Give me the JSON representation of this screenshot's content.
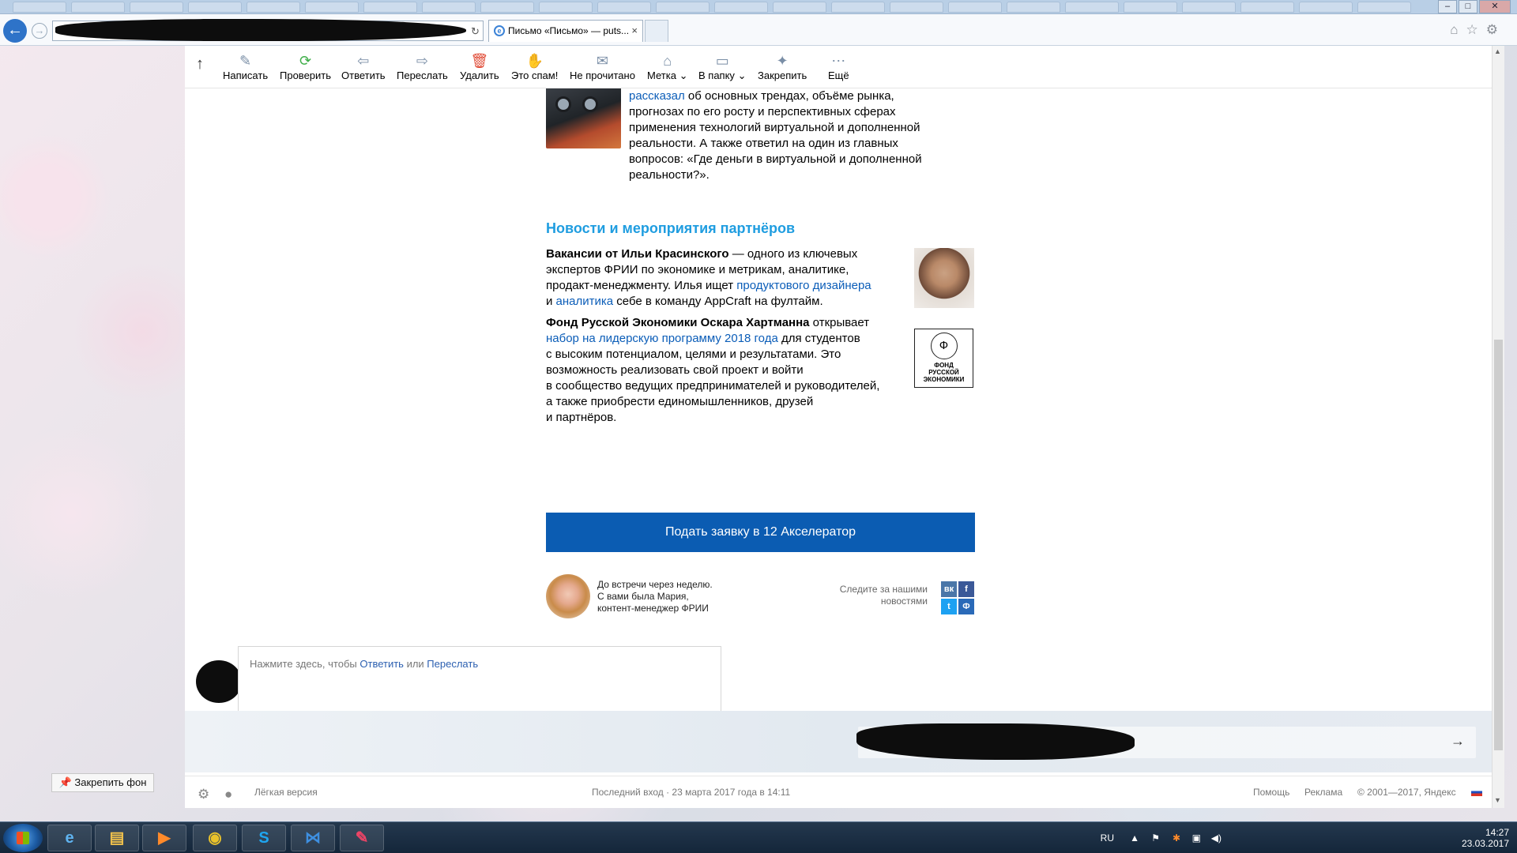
{
  "browser": {
    "tab_title": "Письмо «Письмо» — puts...",
    "tab_close": "×"
  },
  "toolbar": {
    "up_arrow": "↑",
    "items": [
      {
        "label": "Написать",
        "icon": "compose-icon"
      },
      {
        "label": "Проверить",
        "icon": "refresh-icon"
      },
      {
        "label": "Ответить",
        "icon": "reply-icon"
      },
      {
        "label": "Переслать",
        "icon": "forward-icon"
      },
      {
        "label": "Удалить",
        "icon": "trash-icon"
      },
      {
        "label": "Это спам!",
        "icon": "spam-hand-icon"
      },
      {
        "label": "Не прочитано",
        "icon": "envelope-icon"
      },
      {
        "label": "Метка",
        "icon": "tag-icon"
      },
      {
        "label": "В папку",
        "icon": "folder-icon"
      },
      {
        "label": "Закрепить",
        "icon": "pin-icon"
      },
      {
        "label": "Ещё",
        "icon": "more-icon"
      }
    ]
  },
  "mail": {
    "intro": {
      "link": "рассказал",
      "lines": [
        " об основных трендах, объёме рынка,",
        "прогнозах по его росту и перспективных сферах",
        "применения технологий виртуальной и дополненной",
        "реальности. А также ответил на один из главных",
        "вопросов: «Где деньги в виртуальной и дополненной",
        "реальности?»."
      ]
    },
    "section_title": "Новости и мероприятия партнёров",
    "item1": {
      "bold": "Вакансии от Ильи Красинского",
      "text1": " — одного из ключевых",
      "line2": "экспертов ФРИИ по экономике и метрикам, аналитике,",
      "line3a": "продакт-менеджменту. Илья ищет ",
      "link1": "продуктового дизайнера",
      "line4a": "и  ",
      "link2": "аналитика",
      "line4b": " себе в команду AppCraft на фултайм."
    },
    "item2": {
      "bold": "Фонд Русской Экономики Оскара Хартманна",
      "text1": " открывает",
      "link": "набор на лидерскую программу 2018 года",
      "text2": " для студентов",
      "lines": [
        "с высоким потенциалом, целями и результатами. Это",
        "возможность реализовать свой проект и войти",
        "в сообщество ведущих предпринимателей и руководителей,",
        "а также приобрести единомышленников, друзей",
        "и партнёров."
      ],
      "logo_glyph": "Ф",
      "logo_lines": [
        "ФОНД",
        "РУССКОЙ",
        "ЭКОНОМИКИ"
      ]
    },
    "cta_label": "Подать заявку в 12 Акселератор",
    "signature": [
      "До встречи через неделю.",
      "С вами была Мария,",
      "контент-менеджер ФРИИ"
    ],
    "follow_text": [
      "Следите за нашими",
      "новостями"
    ],
    "social": [
      {
        "name": "vk",
        "glyph": "вк",
        "color": "#4a76a8"
      },
      {
        "name": "facebook",
        "glyph": "f",
        "color": "#3b5998"
      },
      {
        "name": "twitter",
        "glyph": "t",
        "color": "#1da1f2"
      },
      {
        "name": "frii",
        "glyph": "Ф",
        "color": "#2a6ab8"
      }
    ]
  },
  "reply": {
    "prefix": "Нажмите здесь, чтобы ",
    "reply_link": "Ответить",
    "mid": " или ",
    "forward_link": "Переслать"
  },
  "footer": {
    "light_version": "Лёгкая версия",
    "last_login": "Последний вход · 23 марта 2017 года в 14:11",
    "help": "Помощь",
    "ads": "Реклама",
    "copyright": "© 2001—2017, Яндекс"
  },
  "pin_background": "Закрепить фон",
  "taskbar": {
    "lang": "RU",
    "time": "14:27",
    "date": "23.03.2017"
  }
}
